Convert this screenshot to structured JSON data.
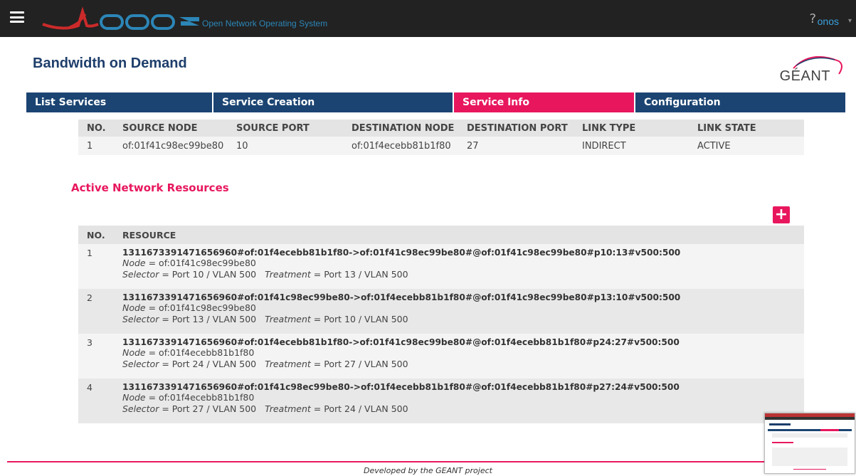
{
  "header": {
    "brand_sub": "Open Network Operating System",
    "help": "?",
    "user": "onos",
    "user_caret": "▾"
  },
  "page": {
    "title": "Bandwidth on Demand",
    "partner": "GÉANT"
  },
  "tabs": [
    {
      "label": "List Services",
      "active": false
    },
    {
      "label": "Service Creation",
      "active": false
    },
    {
      "label": "Service Info",
      "active": true
    },
    {
      "label": "Configuration",
      "active": false
    }
  ],
  "service": {
    "headers": [
      "NO.",
      "SOURCE NODE",
      "SOURCE PORT",
      "DESTINATION NODE",
      "DESTINATION PORT",
      "LINK TYPE",
      "LINK STATE"
    ],
    "row": [
      "1",
      "of:01f41c98ec99be80",
      "10",
      "of:01f4ecebb81b1f80",
      "27",
      "INDIRECT",
      "ACTIVE"
    ]
  },
  "resources": {
    "title": "Active Network Resources",
    "add_label": "+",
    "headers": [
      "NO.",
      "RESOURCE"
    ],
    "rows": [
      {
        "no": "1",
        "id": "1311673391471656960#of:01f4ecebb81b1f80->of:01f41c98ec99be80#@of:01f41c98ec99be80#p10:13#v500:500",
        "node": "of:01f41c98ec99be80",
        "selector": "Port 10 / VLAN 500",
        "treatment": "Port 13 / VLAN 500"
      },
      {
        "no": "2",
        "id": "1311673391471656960#of:01f41c98ec99be80->of:01f4ecebb81b1f80#@of:01f41c98ec99be80#p13:10#v500:500",
        "node": "of:01f41c98ec99be80",
        "selector": "Port 13 / VLAN 500",
        "treatment": "Port 10 / VLAN 500"
      },
      {
        "no": "3",
        "id": "1311673391471656960#of:01f4ecebb81b1f80->of:01f41c98ec99be80#@of:01f4ecebb81b1f80#p24:27#v500:500",
        "node": "of:01f4ecebb81b1f80",
        "selector": "Port 24 / VLAN 500",
        "treatment": "Port 27 / VLAN 500"
      },
      {
        "no": "4",
        "id": "1311673391471656960#of:01f41c98ec99be80->of:01f4ecebb81b1f80#@of:01f4ecebb81b1f80#p27:24#v500:500",
        "node": "of:01f4ecebb81b1f80",
        "selector": "Port 27 / VLAN 500",
        "treatment": "Port 24 / VLAN 500"
      }
    ]
  },
  "labels": {
    "node": "Node",
    "selector": "Selector",
    "treatment": "Treatment"
  },
  "footer": {
    "text": "Developed by the GEANT project"
  },
  "colors": {
    "accent": "#e8175d",
    "nav": "#1b4472",
    "title": "#1e3e6b"
  }
}
